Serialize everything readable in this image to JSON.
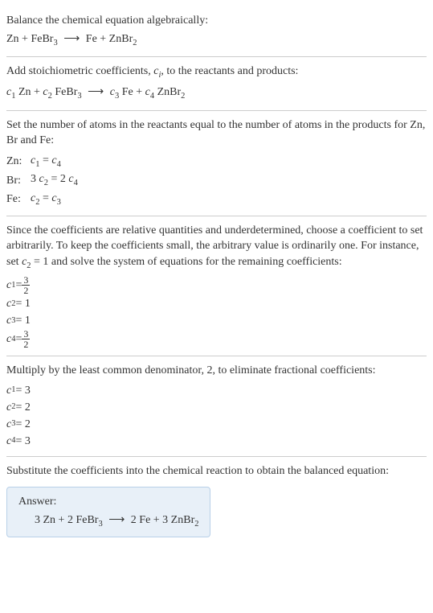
{
  "section1": {
    "line1": "Balance the chemical equation algebraically:",
    "eq_lhs1": "Zn + FeBr",
    "eq_sub1": "3",
    "arrow": "⟶",
    "eq_rhs1": "Fe + ZnBr",
    "eq_sub2": "2"
  },
  "section2": {
    "line1_a": "Add stoichiometric coefficients, ",
    "ci": "c",
    "ci_sub": "i",
    "line1_b": ", to the reactants and products:",
    "c1": "c",
    "c1_sub": "1",
    "t1": " Zn + ",
    "c2": "c",
    "c2_sub": "2",
    "t2": " FeBr",
    "t2_sub": "3",
    "arrow": "⟶",
    "c3": "c",
    "c3_sub": "3",
    "t3": " Fe + ",
    "c4": "c",
    "c4_sub": "4",
    "t4": " ZnBr",
    "t4_sub": "2"
  },
  "section3": {
    "line1": "Set the number of atoms in the reactants equal to the number of atoms in the products for Zn, Br and Fe:",
    "rows": [
      {
        "label": "Zn:",
        "c_a": "c",
        "sub_a": "1",
        "mid": " = ",
        "c_b": "c",
        "sub_b": "4",
        "pre_a": "",
        "pre_b": ""
      },
      {
        "label": "Br:",
        "c_a": "c",
        "sub_a": "2",
        "mid": " = 2 ",
        "c_b": "c",
        "sub_b": "4",
        "pre_a": "3 ",
        "pre_b": ""
      },
      {
        "label": "Fe:",
        "c_a": "c",
        "sub_a": "2",
        "mid": " = ",
        "c_b": "c",
        "sub_b": "3",
        "pre_a": "",
        "pre_b": ""
      }
    ]
  },
  "section4": {
    "line1_a": "Since the coefficients are relative quantities and underdetermined, choose a coefficient to set arbitrarily. To keep the coefficients small, the arbitrary value is ordinarily one. For instance, set ",
    "c2": "c",
    "c2_sub": "2",
    "line1_b": " = 1 and solve the system of equations for the remaining coefficients:",
    "r1_c": "c",
    "r1_sub": "1",
    "r1_eq": " = ",
    "r1_num": "3",
    "r1_den": "2",
    "r2_c": "c",
    "r2_sub": "2",
    "r2_val": " = 1",
    "r3_c": "c",
    "r3_sub": "3",
    "r3_val": " = 1",
    "r4_c": "c",
    "r4_sub": "4",
    "r4_eq": " = ",
    "r4_num": "3",
    "r4_den": "2"
  },
  "section5": {
    "line1": "Multiply by the least common denominator, 2, to eliminate fractional coefficients:",
    "r1_c": "c",
    "r1_sub": "1",
    "r1_val": " = 3",
    "r2_c": "c",
    "r2_sub": "2",
    "r2_val": " = 2",
    "r3_c": "c",
    "r3_sub": "3",
    "r3_val": " = 2",
    "r4_c": "c",
    "r4_sub": "4",
    "r4_val": " = 3"
  },
  "section6": {
    "line1": "Substitute the coefficients into the chemical reaction to obtain the balanced equation:",
    "answer_label": "Answer:",
    "eq_a": "3 Zn + 2 FeBr",
    "eq_a_sub": "3",
    "arrow": "⟶",
    "eq_b": "2 Fe + 3 ZnBr",
    "eq_b_sub": "2"
  }
}
